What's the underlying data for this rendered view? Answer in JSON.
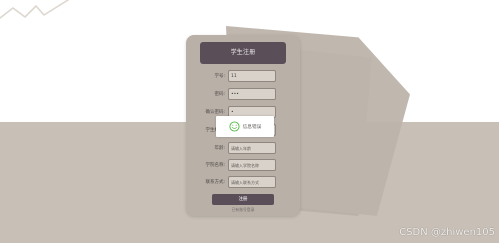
{
  "form": {
    "title": "学生注册",
    "fields": [
      {
        "label": "学号:",
        "value": "11",
        "placeholder": ""
      },
      {
        "label": "密码:",
        "value": "•••",
        "placeholder": ""
      },
      {
        "label": "确认密码:",
        "value": "•",
        "placeholder": ""
      },
      {
        "label": "学生姓名:",
        "value": "",
        "placeholder": ""
      },
      {
        "label": "年龄:",
        "value": "",
        "placeholder": "请输入年龄"
      },
      {
        "label": "学院名称:",
        "value": "",
        "placeholder": "请输入学院名称"
      },
      {
        "label": "联系方式:",
        "value": "",
        "placeholder": "请输入联系方式"
      }
    ],
    "submit_label": "注册",
    "login_link": "已有账号登录"
  },
  "toast": {
    "text": "信息错误",
    "icon": "smile-icon"
  },
  "watermark": {
    "text": "CSDN @zhiwen105"
  },
  "colors": {
    "header": "#5a4f58",
    "card": "#b9b0a8",
    "background": "#c8c0b6",
    "input": "#d9d2cb"
  }
}
